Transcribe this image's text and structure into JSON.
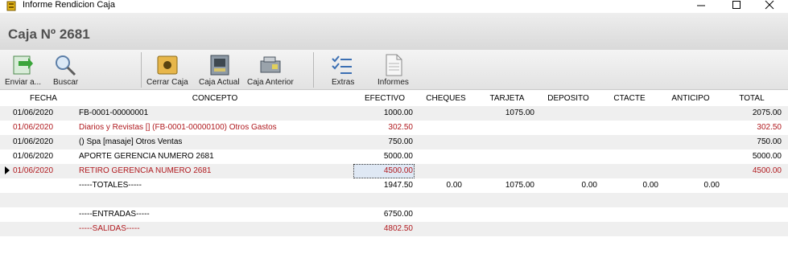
{
  "window": {
    "title": "Informe Rendicion Caja",
    "min_icon": "minimize-icon",
    "max_icon": "maximize-icon",
    "close_icon": "close-icon"
  },
  "header": {
    "title": "Caja Nº 2681"
  },
  "toolbar": {
    "enviar": "Enviar a...",
    "buscar": "Buscar",
    "cerrar_caja": "Cerrar Caja",
    "caja_actual": "Caja Actual",
    "caja_anterior": "Caja Anterior",
    "extras": "Extras",
    "informes": "Informes"
  },
  "columns": {
    "fecha": "FECHA",
    "concepto": "CONCEPTO",
    "efectivo": "EFECTIVO",
    "cheques": "CHEQUES",
    "tarjeta": "TARJETA",
    "deposito": "DEPOSITO",
    "ctacte": "CTACTE",
    "anticipo": "ANTICIPO",
    "total": "TOTAL"
  },
  "rows": [
    {
      "fecha": "01/06/2020",
      "concepto": "FB-0001-00000001",
      "efectivo": "1000.00",
      "cheques": "",
      "tarjeta": "1075.00",
      "deposito": "",
      "ctacte": "",
      "anticipo": "",
      "total": "2075.00"
    },
    {
      "fecha": "01/06/2020",
      "concepto": "Diarios y Revistas [] (FB-0001-00000100) Otros Gastos",
      "efectivo": "302.50",
      "cheques": "",
      "tarjeta": "",
      "deposito": "",
      "ctacte": "",
      "anticipo": "",
      "total": "302.50"
    },
    {
      "fecha": "01/06/2020",
      "concepto": "() Spa  [masaje] Otros Ventas",
      "efectivo": "750.00",
      "cheques": "",
      "tarjeta": "",
      "deposito": "",
      "ctacte": "",
      "anticipo": "",
      "total": "750.00"
    },
    {
      "fecha": "01/06/2020",
      "concepto": "APORTE GERENCIA NUMERO 2681",
      "efectivo": "5000.00",
      "cheques": "",
      "tarjeta": "",
      "deposito": "",
      "ctacte": "",
      "anticipo": "",
      "total": "5000.00"
    },
    {
      "fecha": "01/06/2020",
      "concepto": "RETIRO GERENCIA NUMERO 2681",
      "efectivo": "4500.00",
      "cheques": "",
      "tarjeta": "",
      "deposito": "",
      "ctacte": "",
      "anticipo": "",
      "total": "4500.00"
    },
    {
      "fecha": "",
      "concepto": "-----TOTALES-----",
      "efectivo": "1947.50",
      "cheques": "0.00",
      "tarjeta": "1075.00",
      "deposito": "0.00",
      "ctacte": "0.00",
      "anticipo": "0.00",
      "total": ""
    },
    {
      "fecha": "",
      "concepto": "",
      "efectivo": "",
      "cheques": "",
      "tarjeta": "",
      "deposito": "",
      "ctacte": "",
      "anticipo": "",
      "total": ""
    },
    {
      "fecha": "",
      "concepto": "-----ENTRADAS-----",
      "efectivo": "6750.00",
      "cheques": "",
      "tarjeta": "",
      "deposito": "",
      "ctacte": "",
      "anticipo": "",
      "total": ""
    },
    {
      "fecha": "",
      "concepto": "-----SALIDAS-----",
      "efectivo": "4802.50",
      "cheques": "",
      "tarjeta": "",
      "deposito": "",
      "ctacte": "",
      "anticipo": "",
      "total": ""
    }
  ],
  "colors": {
    "negative": "#b0191e",
    "alt_row": "#efefef"
  }
}
